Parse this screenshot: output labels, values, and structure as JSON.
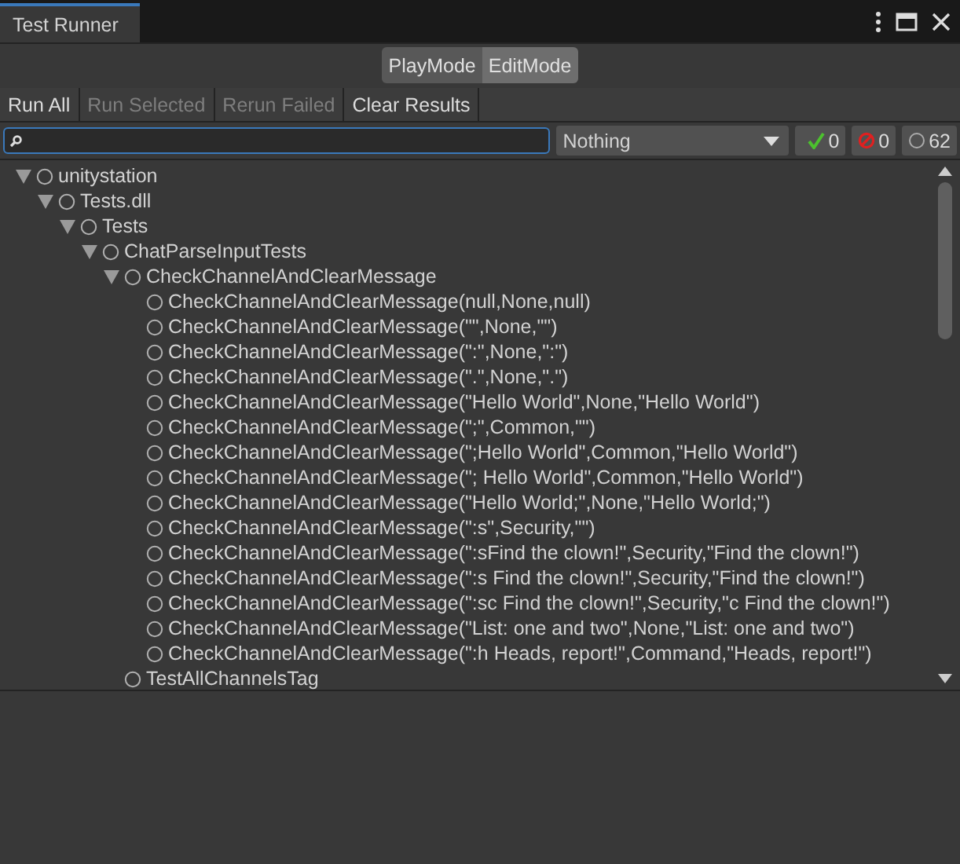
{
  "window": {
    "tab": "Test Runner"
  },
  "modes": [
    {
      "label": "PlayMode",
      "selected": false
    },
    {
      "label": "EditMode",
      "selected": true
    }
  ],
  "toolbar": [
    {
      "label": "Run All",
      "disabled": false
    },
    {
      "label": "Run Selected",
      "disabled": true
    },
    {
      "label": "Rerun Failed",
      "disabled": true
    },
    {
      "label": "Clear Results",
      "disabled": false
    }
  ],
  "filter": {
    "value": "Nothing"
  },
  "counters": [
    {
      "kind": "passed",
      "count": "0"
    },
    {
      "kind": "failed",
      "count": "0"
    },
    {
      "kind": "notrun",
      "count": "62"
    }
  ],
  "tree": [
    {
      "label": "unitystation",
      "expanded": true,
      "children": [
        {
          "label": "Tests.dll",
          "expanded": true,
          "children": [
            {
              "label": "Tests",
              "expanded": true,
              "children": [
                {
                  "label": "ChatParseInputTests",
                  "expanded": true,
                  "children": [
                    {
                      "label": "CheckChannelAndClearMessage",
                      "expanded": true,
                      "children": [
                        {
                          "label": "CheckChannelAndClearMessage(null,None,null)"
                        },
                        {
                          "label": "CheckChannelAndClearMessage(\"\",None,\"\")"
                        },
                        {
                          "label": "CheckChannelAndClearMessage(\":\",None,\":\")"
                        },
                        {
                          "label": "CheckChannelAndClearMessage(\".\",None,\".\")"
                        },
                        {
                          "label": "CheckChannelAndClearMessage(\"Hello World\",None,\"Hello World\")"
                        },
                        {
                          "label": "CheckChannelAndClearMessage(\";\",Common,\"\")"
                        },
                        {
                          "label": "CheckChannelAndClearMessage(\";Hello World\",Common,\"Hello World\")"
                        },
                        {
                          "label": "CheckChannelAndClearMessage(\"; Hello World\",Common,\"Hello World\")"
                        },
                        {
                          "label": "CheckChannelAndClearMessage(\"Hello World;\",None,\"Hello World;\")"
                        },
                        {
                          "label": "CheckChannelAndClearMessage(\":s\",Security,\"\")"
                        },
                        {
                          "label": "CheckChannelAndClearMessage(\":sFind the clown!\",Security,\"Find the clown!\")"
                        },
                        {
                          "label": "CheckChannelAndClearMessage(\":s Find the clown!\",Security,\"Find the clown!\")"
                        },
                        {
                          "label": "CheckChannelAndClearMessage(\":sc Find the clown!\",Security,\"c Find the clown!\")"
                        },
                        {
                          "label": "CheckChannelAndClearMessage(\"List: one and two\",None,\"List: one and two\")"
                        },
                        {
                          "label": "CheckChannelAndClearMessage(\":h Heads, report!\",Command,\"Heads, report!\")"
                        }
                      ]
                    },
                    {
                      "label": "TestAllChannelsTag"
                    }
                  ]
                }
              ]
            }
          ]
        }
      ]
    }
  ]
}
